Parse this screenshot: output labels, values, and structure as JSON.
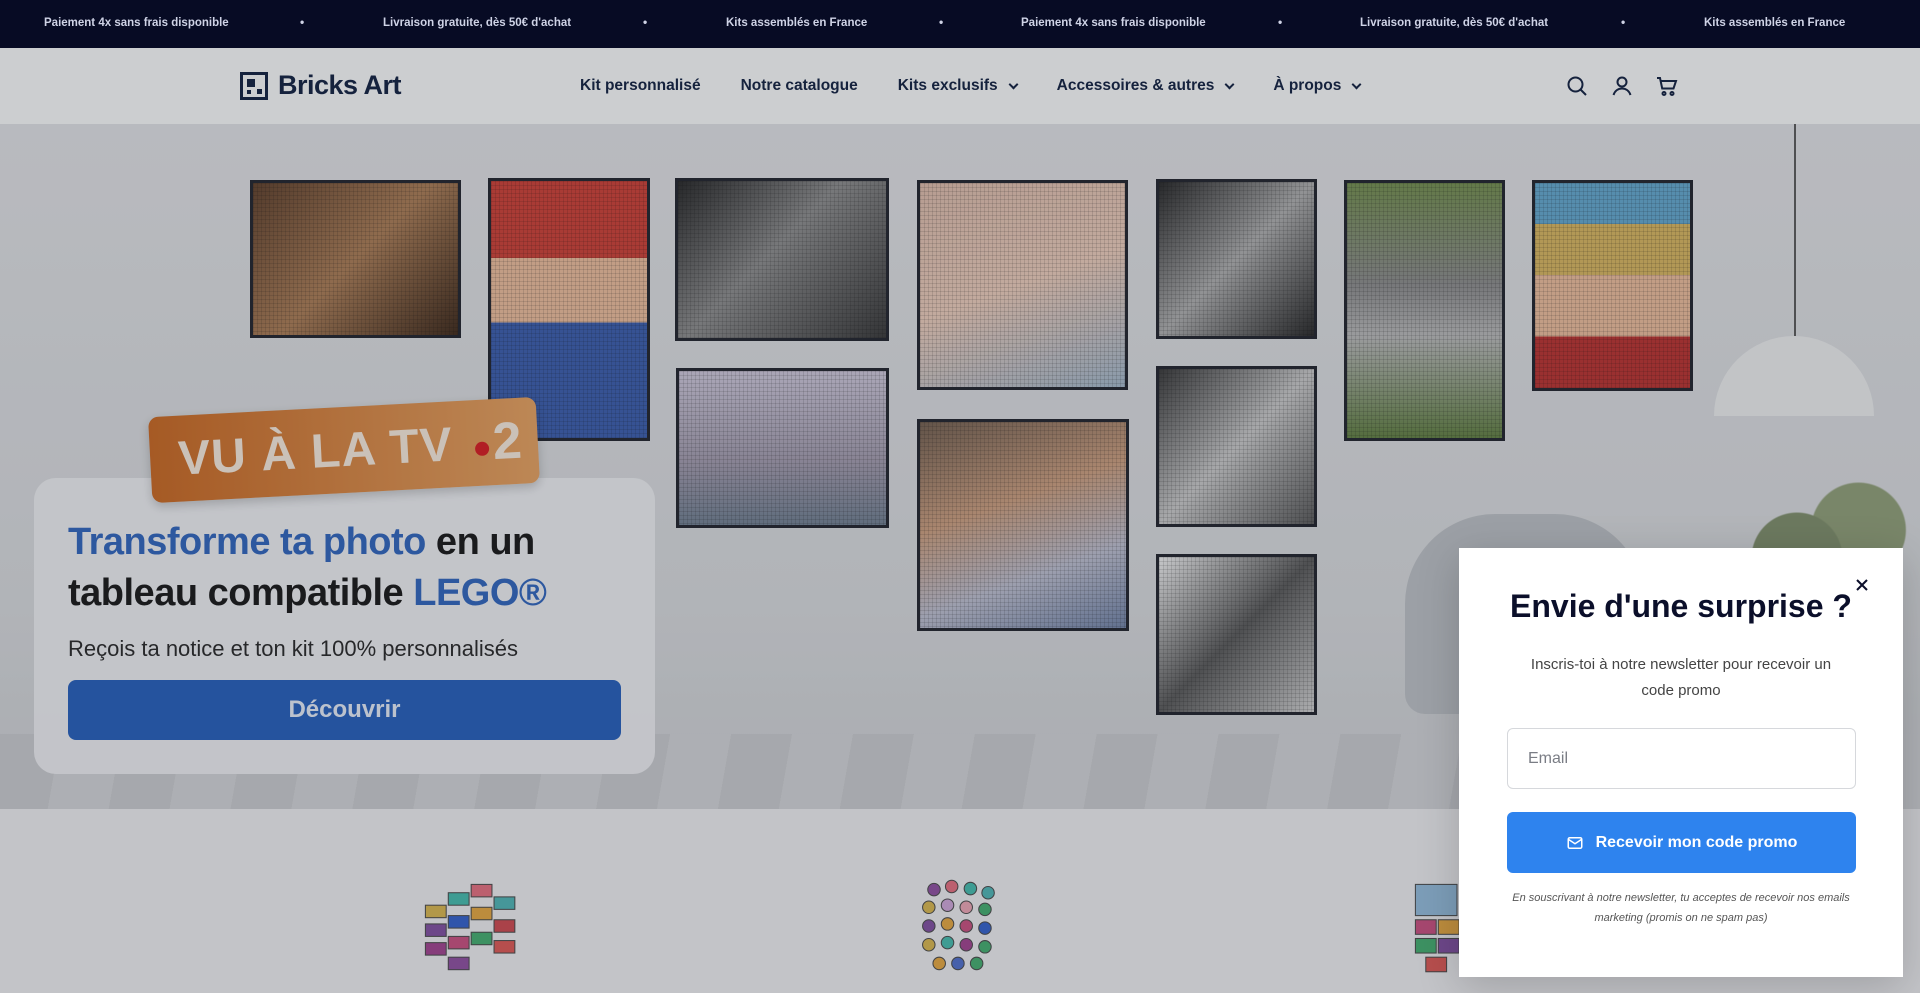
{
  "announcement": {
    "items": [
      "Paiement 4x sans frais disponible",
      "Livraison gratuite, dès 50€ d'achat",
      "Kits assemblés en France",
      "Paiement 4x sans frais disponible",
      "Livraison gratuite, dès 50€ d'achat",
      "Kits assemblés en France"
    ],
    "separator": "•"
  },
  "header": {
    "brand": "Bricks Art",
    "nav": [
      {
        "label": "Kit personnalisé",
        "has_dropdown": false
      },
      {
        "label": "Notre catalogue",
        "has_dropdown": false
      },
      {
        "label": "Kits exclusifs",
        "has_dropdown": true
      },
      {
        "label": "Accessoires & autres",
        "has_dropdown": true
      },
      {
        "label": "À propos",
        "has_dropdown": true
      }
    ],
    "icons": [
      "search-icon",
      "account-icon",
      "cart-icon"
    ]
  },
  "hero": {
    "tv_badge": {
      "text": "VU À LA TV",
      "channel": "2"
    },
    "title_part1": "Transforme ta photo",
    "title_part2": " en un tableau compatible ",
    "title_part3": "LEGO®",
    "subtitle": "Reçois ta notice et ton kit 100% personnalisés",
    "cta": "Découvrir"
  },
  "popup": {
    "title": "Envie d'une surprise ?",
    "description": "Inscris-toi à notre newsletter pour recevoir un code promo",
    "email_placeholder": "Email",
    "button": "Recevoir mon code promo",
    "legal": "En souscrivant à notre newsletter, tu acceptes de recevoir nos emails marketing (promis on ne spam pas)"
  },
  "colors": {
    "announcement_bg": "#070b24",
    "brand_dark": "#0b1a3a",
    "hero_blue": "#1f59b6",
    "popup_button": "#2e83ee"
  }
}
